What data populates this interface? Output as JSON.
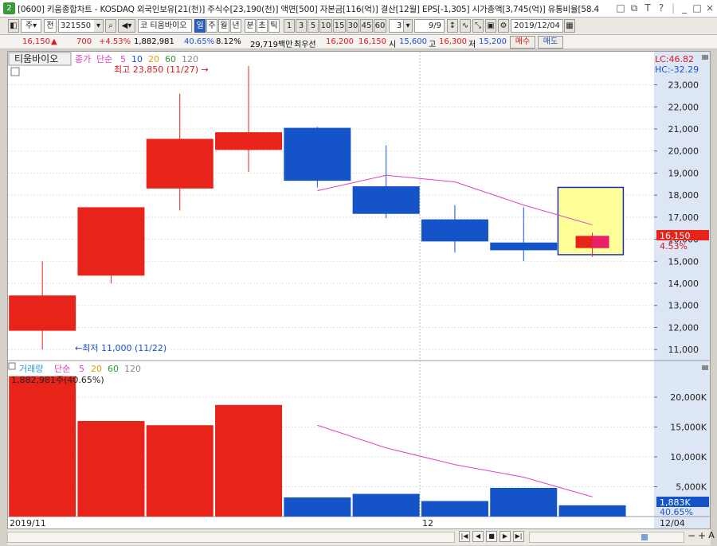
{
  "window": {
    "number": "2",
    "title": "[0600] 키움종합차트 - KOSDAQ 외국인보유[21(천)] 주식수[23,190(천)] 액면[500] 자본금[116(억)] 결산[12월] EPS[-1,305] 시가총액[3,745(억)] 유통비율[58.4",
    "buttons": [
      "□",
      "⧉",
      "T",
      "?",
      "|",
      "_",
      "□",
      "×"
    ]
  },
  "toolbar": {
    "period_label": "주",
    "all_label": "전",
    "code": "321550",
    "stock_name_prefix": "코",
    "stock_name": "티움바이오",
    "timeframes": [
      "일",
      "주",
      "월",
      "년",
      "분",
      "초",
      "틱"
    ],
    "intervals": [
      "1",
      "3",
      "5",
      "10",
      "15",
      "30",
      "45",
      "60"
    ],
    "custom_interval": "3",
    "page": "9/9",
    "date": "2019/12/04"
  },
  "quote": {
    "price": "16,150",
    "arrow": "▲",
    "change": "700",
    "change_pct": "+4.53%",
    "volume": "1,882,981",
    "vol_ratio": "40.65%",
    "turnover": "8.12%",
    "amount": "29,719백만",
    "best_label": "최우선",
    "best_ask": "16,200",
    "best_bid": "16,150",
    "open_label": "시",
    "open": "15,600",
    "high_label": "고",
    "high": "16,300",
    "low_label": "저",
    "low": "15,200",
    "buy_label": "매수",
    "sell_label": "매도"
  },
  "chart_data": [
    {
      "type": "candlestick",
      "legend": {
        "name": "티움바이오",
        "price_label": "종가",
        "ma_label": "단순",
        "ma_periods": [
          "5",
          "10",
          "20",
          "60",
          "120"
        ]
      },
      "lc": "LC:46.82",
      "hc": "HC:-32.29",
      "annotations": {
        "high": "최고 23,850 (11/27) →",
        "low": "←최저 11,000 (11/22)"
      },
      "current_price_label": "16,150",
      "current_pct_label": "4.53%",
      "ylim": [
        10500,
        24500
      ],
      "yticks": [
        "23,000",
        "22,000",
        "21,000",
        "20,000",
        "19,000",
        "18,000",
        "17,000",
        "16,000",
        "15,000",
        "14,000",
        "13,000",
        "12,000",
        "11,000"
      ],
      "candles": [
        {
          "open": 11850,
          "high": 15000,
          "low": 11000,
          "close": 13450
        },
        {
          "open": 14350,
          "high": 14350,
          "low": 14000,
          "close": 17450
        },
        {
          "open": 18300,
          "high": 22600,
          "low": 17300,
          "close": 20550
        },
        {
          "open": 20050,
          "high": 23850,
          "low": 19050,
          "close": 20850
        },
        {
          "open": 21050,
          "high": 21100,
          "low": 18350,
          "close": 18650
        },
        {
          "open": 18400,
          "high": 20250,
          "low": 16950,
          "close": 17150
        },
        {
          "open": 16900,
          "high": 17550,
          "low": 15400,
          "close": 15900
        },
        {
          "open": 15850,
          "high": 17450,
          "low": 15000,
          "close": 15500
        },
        {
          "open": 15600,
          "high": 16300,
          "low": 15200,
          "close": 16150
        }
      ],
      "ma5": [
        null,
        null,
        null,
        null,
        18200,
        18900,
        18600,
        17550,
        16650
      ],
      "colors": {
        "up": "#e8231a",
        "down": "#1553c9",
        "ma5": "#e040c8",
        "highlight": "#ffff99",
        "current_up": "#e8206a"
      }
    },
    {
      "type": "bar",
      "legend": {
        "name": "거래량",
        "ma_label": "단순",
        "ma_periods": [
          "5",
          "20",
          "60",
          "120"
        ]
      },
      "value_label": "1,882,981주(40.65%)",
      "ylim": [
        0,
        24000
      ],
      "yticks": [
        "20,000K",
        "15,000K",
        "10,000K",
        "5,000K"
      ],
      "current_label": "1,883K",
      "current_pct": "40.65%",
      "volumes": [
        23500,
        16000,
        15300,
        18700,
        3200,
        3800,
        2600,
        4800,
        1883
      ],
      "ma5": [
        null,
        null,
        null,
        null,
        15300,
        11500,
        8700,
        6600,
        3300
      ],
      "colors": {
        "up": "#e8231a",
        "down": "#1553c9",
        "ma5": "#e040c8"
      }
    }
  ],
  "xaxis": {
    "labels": [
      "2019/11",
      "12",
      "12/04"
    ]
  },
  "bottom": {
    "buttons": [
      "|◀",
      "◀",
      "■",
      "▶",
      "▶|"
    ],
    "zoom": [
      "−",
      "+",
      "A"
    ]
  }
}
